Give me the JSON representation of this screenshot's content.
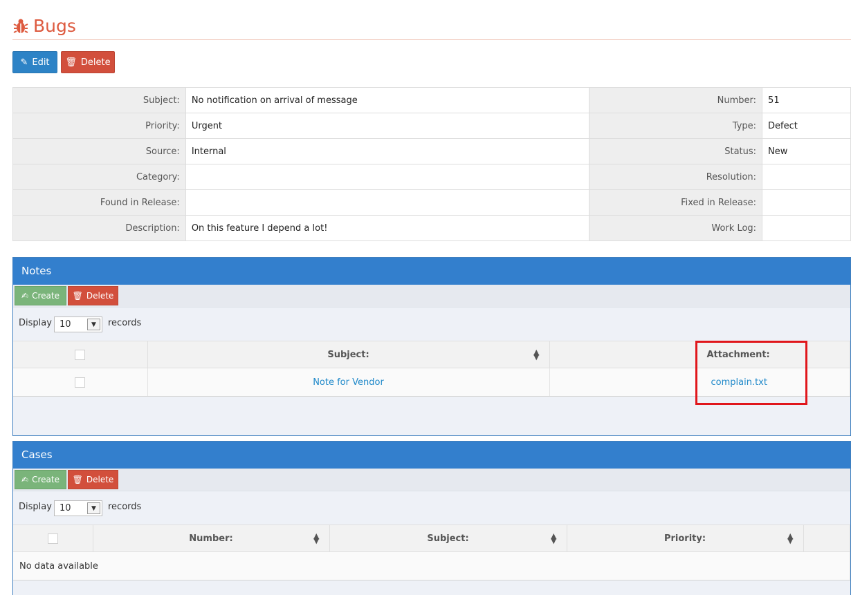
{
  "header": {
    "title": "Bugs",
    "icon": "bug-icon",
    "color": "#dd5a3f"
  },
  "actions": {
    "edit_label": "Edit",
    "delete_label": "Delete"
  },
  "details": {
    "left": [
      {
        "label": "Subject:",
        "value": "No notification on arrival of message"
      },
      {
        "label": "Priority:",
        "value": "Urgent"
      },
      {
        "label": "Source:",
        "value": "Internal"
      },
      {
        "label": "Category:",
        "value": ""
      },
      {
        "label": "Found in Release:",
        "value": ""
      },
      {
        "label": "Description:",
        "value": "On this feature I depend a lot!"
      }
    ],
    "right": [
      {
        "label": "Number:",
        "value": "51"
      },
      {
        "label": "Type:",
        "value": "Defect"
      },
      {
        "label": "Status:",
        "value": "New"
      },
      {
        "label": "Resolution:",
        "value": ""
      },
      {
        "label": "Fixed in Release:",
        "value": ""
      },
      {
        "label": "Work Log:",
        "value": ""
      }
    ]
  },
  "notes": {
    "title": "Notes",
    "create_label": "Create",
    "delete_label": "Delete",
    "display_label": "Display",
    "records_label": "records",
    "page_size": "10",
    "columns": [
      "Subject:",
      "Attachment:"
    ],
    "rows": [
      {
        "subject": "Note for Vendor",
        "attachment": "complain.txt"
      }
    ]
  },
  "cases": {
    "title": "Cases",
    "create_label": "Create",
    "delete_label": "Delete",
    "display_label": "Display",
    "records_label": "records",
    "page_size": "10",
    "columns": [
      "Number:",
      "Subject:",
      "Priority:"
    ],
    "empty_text": "No data available"
  },
  "colors": {
    "primary": "#337fcd",
    "danger": "#d24f3c",
    "success": "#7ab47a",
    "highlight": "#e0161b"
  }
}
